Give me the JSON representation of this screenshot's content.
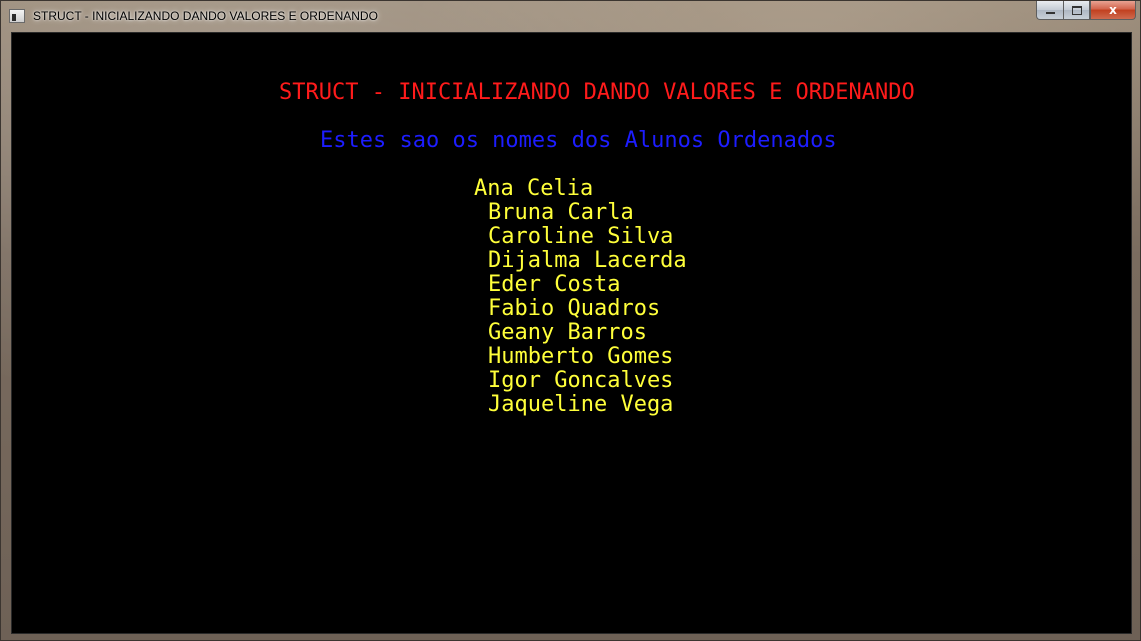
{
  "window": {
    "title": "STRUCT - INICIALIZANDO DANDO VALORES E ORDENANDO",
    "controls": {
      "minimize_icon": "minimize-icon",
      "maximize_icon": "maximize-icon",
      "close_icon": "close-icon",
      "close_glyph": "x"
    }
  },
  "console": {
    "heading": "STRUCT - INICIALIZANDO DANDO VALORES E ORDENANDO",
    "subheading": "Estes sao os nomes dos Alunos Ordenados",
    "names": [
      "Ana Celia",
      "Bruna Carla",
      "Caroline Silva",
      "Dijalma Lacerda",
      "Eder Costa",
      "Fabio Quadros",
      "Geany Barros",
      "Humberto Gomes",
      "Igor Goncalves",
      "Jaqueline Vega"
    ],
    "colors": {
      "background": "#000000",
      "heading": "#ff1b1b",
      "subheading": "#1d1dff",
      "names": "#ffff3a"
    }
  }
}
